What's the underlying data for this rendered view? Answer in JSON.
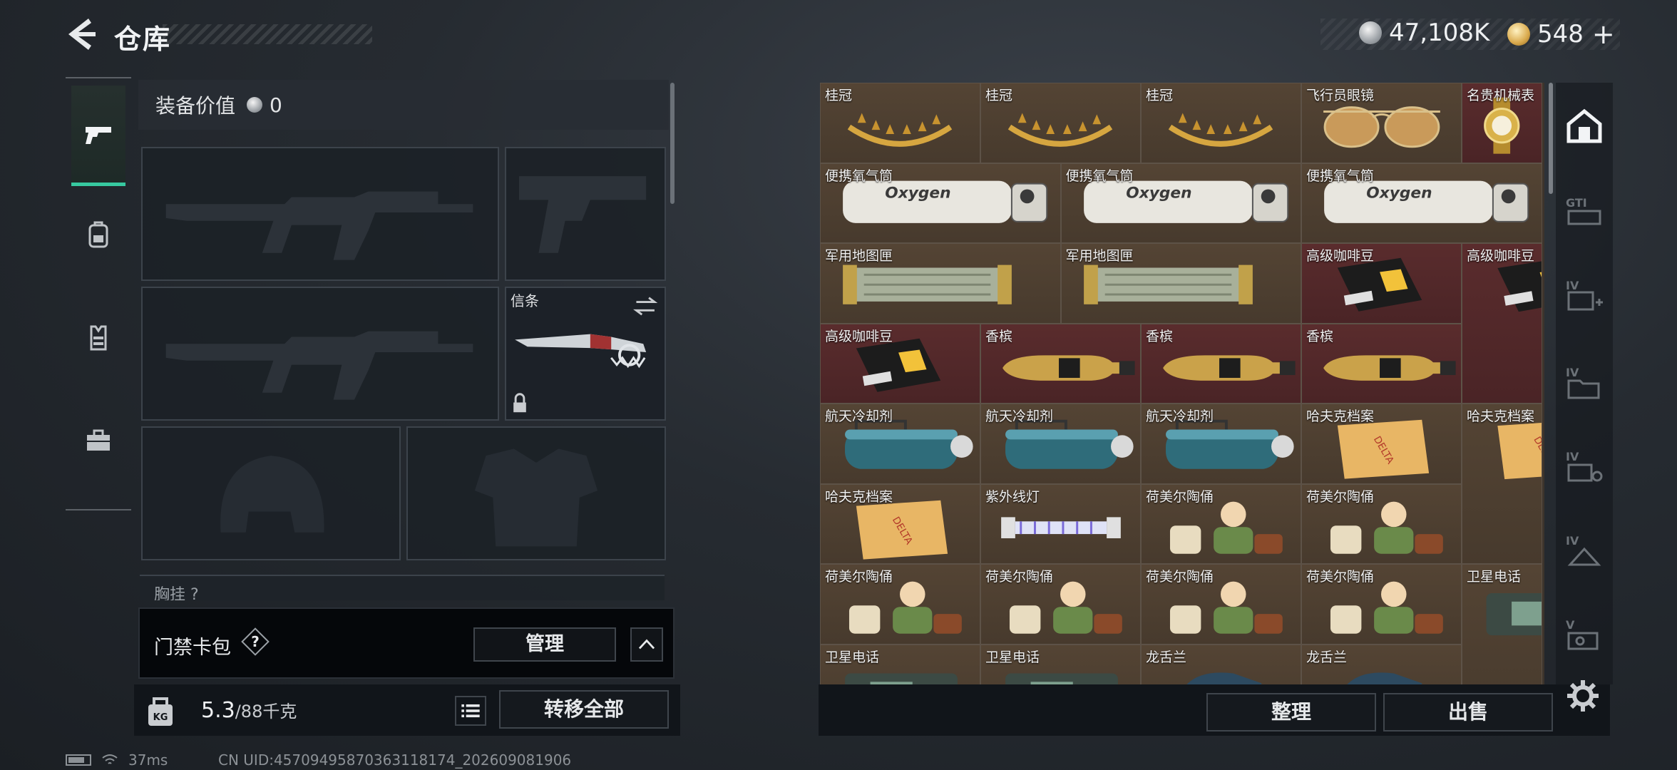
{
  "header": {
    "title": "仓库"
  },
  "currency": {
    "silver": "47,108K",
    "gold": "548",
    "add_label": "+"
  },
  "left_tabs": [
    "weapons-icon",
    "backpack-icon",
    "vest-icon",
    "toolbox-icon"
  ],
  "equipment": {
    "value_label": "装备价值",
    "value": "0",
    "melee_slot_label": "信条",
    "partial_row_label": "胸挂 ?"
  },
  "card_pack": {
    "label": "门禁卡包",
    "help": "?",
    "manage_label": "管理"
  },
  "weight": {
    "current": "5.3",
    "capacity": "/88千克",
    "transfer_all_label": "转移全部"
  },
  "stash": {
    "items": [
      {
        "name": "桂冠",
        "tint": "gold",
        "icon": "laurel-crown-icon"
      },
      {
        "name": "桂冠",
        "tint": "gold",
        "icon": "laurel-crown-icon"
      },
      {
        "name": "桂冠",
        "tint": "gold",
        "icon": "laurel-crown-icon"
      },
      {
        "name": "飞行员眼镜",
        "tint": "gold",
        "icon": "aviator-glasses-icon"
      },
      {
        "name": "名贵机械表",
        "tint": "red",
        "icon": "watch-icon"
      },
      {
        "name": "便携氧气筒",
        "tint": "gold",
        "icon": "oxygen-tank-icon"
      },
      {
        "name": "便携氧气筒",
        "tint": "gold",
        "icon": "oxygen-tank-icon"
      },
      {
        "name": "便携氧气筒",
        "tint": "gold",
        "icon": "oxygen-tank-icon"
      },
      {
        "name": "军用地图匣",
        "tint": "gold",
        "icon": "map-case-icon"
      },
      {
        "name": "军用地图匣",
        "tint": "gold",
        "icon": "map-case-icon"
      },
      {
        "name": "高级咖啡豆",
        "tint": "red",
        "icon": "coffee-bag-icon"
      },
      {
        "name": "高级咖啡豆",
        "tint": "red",
        "icon": "coffee-bag-icon"
      },
      {
        "name": "高级咖啡豆",
        "tint": "red",
        "icon": "coffee-bag-icon"
      },
      {
        "name": "香槟",
        "tint": "red",
        "icon": "champagne-icon"
      },
      {
        "name": "香槟",
        "tint": "red",
        "icon": "champagne-icon"
      },
      {
        "name": "香槟",
        "tint": "red",
        "icon": "champagne-icon"
      },
      {
        "name": "航天冷却剂",
        "tint": "gold",
        "icon": "coolant-icon"
      },
      {
        "name": "航天冷却剂",
        "tint": "gold",
        "icon": "coolant-icon"
      },
      {
        "name": "航天冷却剂",
        "tint": "gold",
        "icon": "coolant-icon"
      },
      {
        "name": "哈夫克档案",
        "tint": "gold",
        "icon": "folder-icon"
      },
      {
        "name": "哈夫克档案",
        "tint": "gold",
        "icon": "folder-icon"
      },
      {
        "name": "哈夫克档案",
        "tint": "gold",
        "icon": "folder-icon"
      },
      {
        "name": "紫外线灯",
        "tint": "gold",
        "icon": "uv-lamp-icon"
      },
      {
        "name": "荷美尔陶俑",
        "tint": "gold",
        "icon": "figurine-icon"
      },
      {
        "name": "荷美尔陶俑",
        "tint": "gold",
        "icon": "figurine-icon"
      },
      {
        "name": "荷美尔陶俑",
        "tint": "gold",
        "icon": "figurine-icon"
      },
      {
        "name": "荷美尔陶俑",
        "tint": "gold",
        "icon": "figurine-icon"
      },
      {
        "name": "荷美尔陶俑",
        "tint": "gold",
        "icon": "figurine-icon"
      },
      {
        "name": "荷美尔陶俑",
        "tint": "gold",
        "icon": "figurine-icon"
      },
      {
        "name": "卫星电话",
        "tint": "gold",
        "icon": "sat-phone-icon"
      },
      {
        "name": "卫星电话",
        "tint": "gold",
        "icon": "sat-phone-icon"
      },
      {
        "name": "卫星电话",
        "tint": "gold",
        "icon": "sat-phone-icon"
      },
      {
        "name": "龙舌兰",
        "tint": "gold",
        "icon": "tequila-icon"
      },
      {
        "name": "龙舌兰",
        "tint": "gold",
        "icon": "tequila-icon"
      }
    ],
    "sort_label": "整理",
    "sell_label": "出售"
  },
  "right_tabs": [
    "home-stash-icon",
    "tier-gt-icon",
    "tier-iv-add-icon",
    "tier-iv-folder-icon",
    "tier-iv-gear-icon",
    "tier-iv-box-icon",
    "tier-v-icon"
  ],
  "status": {
    "ping": "37ms",
    "uid": "CN UID:457094958703631181​74_202609081906"
  }
}
